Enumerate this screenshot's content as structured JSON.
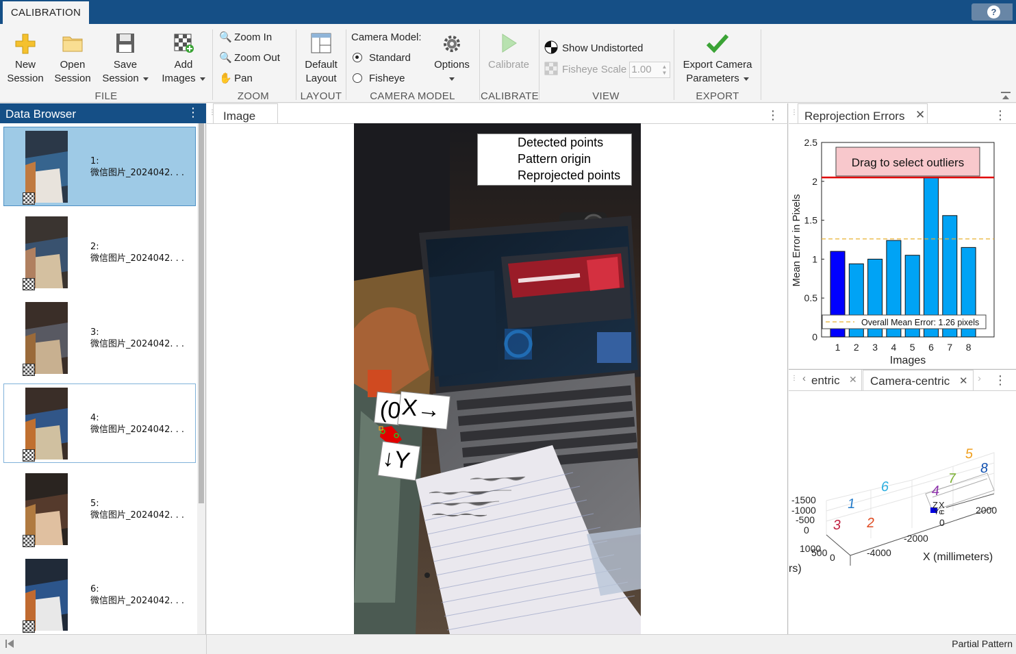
{
  "toolstrip": {
    "tab_label": "CALIBRATION",
    "help_label": "?"
  },
  "file": {
    "new_label_1": "New",
    "new_label_2": "Session",
    "open_label_1": "Open",
    "open_label_2": "Session",
    "save_label_1": "Save",
    "save_label_2": "Session",
    "add_label_1": "Add",
    "add_label_2": "Images",
    "group": "FILE"
  },
  "zoom": {
    "zoom_in": "Zoom In",
    "zoom_out": "Zoom Out",
    "pan": "Pan",
    "group": "ZOOM"
  },
  "layout": {
    "default_1": "Default",
    "default_2": "Layout",
    "group": "LAYOUT"
  },
  "camera_model": {
    "label": "Camera Model:",
    "standard": "Standard",
    "fisheye": "Fisheye",
    "selected": "Standard",
    "options": "Options",
    "group": "CAMERA MODEL"
  },
  "calibrate": {
    "label": "Calibrate",
    "group": "CALIBRATE"
  },
  "view": {
    "show_undistorted": "Show Undistorted",
    "fisheye_scale": "Fisheye Scale",
    "fisheye_scale_value": "1.00",
    "group": "VIEW"
  },
  "export": {
    "label_1": "Export Camera",
    "label_2": "Parameters",
    "group": "EXPORT"
  },
  "data_browser": {
    "title": "Data Browser",
    "items": [
      {
        "index": "1:",
        "name": "微信图片_2024042. . ."
      },
      {
        "index": "2:",
        "name": "微信图片_2024042. . ."
      },
      {
        "index": "3:",
        "name": "微信图片_2024042. . ."
      },
      {
        "index": "4:",
        "name": "微信图片_2024042. . ."
      },
      {
        "index": "5:",
        "name": "微信图片_2024042. . ."
      },
      {
        "index": "6:",
        "name": "微信图片_2024042. . ."
      }
    ]
  },
  "image_panel": {
    "tab": "Image",
    "legend": [
      "Detected points",
      "Pattern origin",
      "Reprojected points"
    ],
    "axis_labels": {
      "origin": "(0",
      "x": "X→",
      "y": "↓Y"
    }
  },
  "reprojection": {
    "tab": "Reprojection Errors",
    "drag_label": "Drag to select outliers",
    "mean_label": "Overall Mean Error: 1.26 pixels"
  },
  "chart_data": {
    "type": "bar",
    "categories": [
      "1",
      "2",
      "3",
      "4",
      "5",
      "6",
      "7",
      "8"
    ],
    "values": [
      1.1,
      0.94,
      1.0,
      1.24,
      1.05,
      2.05,
      1.56,
      1.15
    ],
    "highlighted_category": "1",
    "xlabel": "Images",
    "ylabel": "Mean Error in Pixels",
    "ylim": [
      0,
      2.5
    ],
    "yticks": [
      "0",
      "0.5",
      "1",
      "1.5",
      "2",
      "2.5"
    ],
    "mean_line": 1.26,
    "threshold_line": 2.05,
    "colors": {
      "bar": "#00a3f5",
      "selected_bar": "#0000ff",
      "threshold": "#e00000",
      "mean": "#e8b030"
    }
  },
  "extrinsics": {
    "tab_left": "entric",
    "tab_right": "Camera-centric",
    "numbers": [
      "1",
      "2",
      "3",
      "4",
      "5",
      "6",
      "7",
      "8"
    ],
    "z_ticks": [
      "-1500",
      "-1000",
      "-500",
      "0"
    ],
    "y_ticks": [
      "1000",
      "500",
      "0"
    ],
    "x_ticks": [
      "-4000",
      "-2000",
      "0",
      "2000"
    ],
    "x_label": "X (millimeters)",
    "y_label_fragment": "rs)",
    "axes_marker_labels": [
      "Z",
      "X",
      "Yc",
      "c"
    ]
  },
  "status": {
    "text": "Partial Pattern"
  }
}
